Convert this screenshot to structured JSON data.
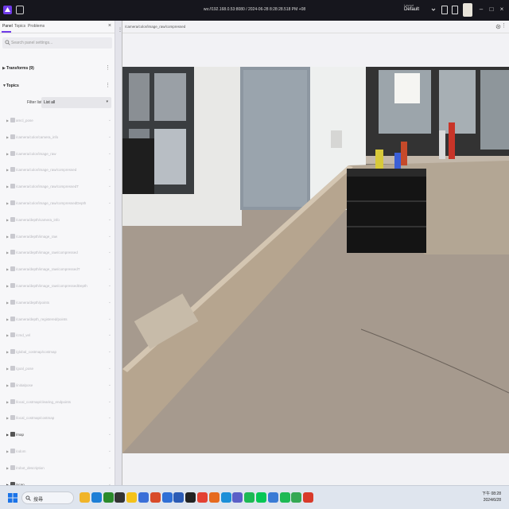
{
  "appbar": {
    "url": "ws://192.168.0.53:8080 / 2024-06-28 8:28:28.518 PM +08",
    "layout_label": "Layout",
    "layout_value": "Default"
  },
  "panel": {
    "tabs": [
      "Panel",
      "Topics",
      "Problems"
    ],
    "search_placeholder": "Search panel settings...",
    "transforms_label": "Transforms (9)",
    "topics_label": "Topics",
    "filter_label": "Filter list",
    "filter_value": "List all",
    "topics": [
      {
        "name": "amcl_pose",
        "strong": false
      },
      {
        "name": "/camera/color/camera_info",
        "strong": false
      },
      {
        "name": "/camera/color/image_raw",
        "strong": false
      },
      {
        "name": "/camera/color/image_raw/compressed",
        "strong": false
      },
      {
        "name": "/camera/color/image_raw/compressedT",
        "strong": false
      },
      {
        "name": "/camera/color/image_raw/compressedDepth",
        "strong": false
      },
      {
        "name": "/camera/depth/camera_info",
        "strong": false
      },
      {
        "name": "/camera/depth/image_raw",
        "strong": false
      },
      {
        "name": "/camera/depth/image_raw/compressed",
        "strong": false
      },
      {
        "name": "/camera/depth/image_raw/compressedT",
        "strong": false
      },
      {
        "name": "/camera/depth/image_raw/compressedDepth",
        "strong": false
      },
      {
        "name": "/camera/depth/points",
        "strong": false
      },
      {
        "name": "/camera/depth_registered/points",
        "strong": false
      },
      {
        "name": "/cmd_vel",
        "strong": false
      },
      {
        "name": "/global_costmap/costmap",
        "strong": false
      },
      {
        "name": "/goal_pose",
        "strong": false
      },
      {
        "name": "/initialpose",
        "strong": false
      },
      {
        "name": "/local_costmap/clearing_endpoints",
        "strong": false
      },
      {
        "name": "/local_costmap/costmap",
        "strong": false
      },
      {
        "name": "/map",
        "strong": true
      },
      {
        "name": "/odom",
        "strong": false
      },
      {
        "name": "/robot_description",
        "strong": false
      },
      {
        "name": "/scan",
        "strong": true
      }
    ]
  },
  "image_panel": {
    "topic": "/camera/color/image_raw/compressed"
  },
  "taskbar": {
    "search_placeholder": "搜尋",
    "time": "下午 08:28",
    "date": "2024/6/28",
    "apps": [
      {
        "name": "files-app",
        "color": "#f0b429"
      },
      {
        "name": "vscode-app",
        "color": "#1e7fd6"
      },
      {
        "name": "xbox-app",
        "color": "#2b8a2b"
      },
      {
        "name": "terminal-app",
        "color": "#333333"
      },
      {
        "name": "sticky-app",
        "color": "#f4c21a"
      },
      {
        "name": "photos-app",
        "color": "#3a6fd8"
      },
      {
        "name": "office-app",
        "color": "#d84b2a"
      },
      {
        "name": "calendar-app",
        "color": "#2f6fd6"
      },
      {
        "name": "word-app",
        "color": "#2b5bb5"
      },
      {
        "name": "terminal2-app",
        "color": "#222222"
      },
      {
        "name": "chrome-app",
        "color": "#e34133"
      },
      {
        "name": "firefox-app",
        "color": "#e66a1f"
      },
      {
        "name": "edge-app",
        "color": "#1c8fd8"
      },
      {
        "name": "teams-app",
        "color": "#5b5fc7"
      },
      {
        "name": "spotify-app",
        "color": "#1db954"
      },
      {
        "name": "line-app",
        "color": "#06c755"
      },
      {
        "name": "remote-app",
        "color": "#3a7bd5"
      },
      {
        "name": "spotify2-app",
        "color": "#1db954"
      },
      {
        "name": "maps-app",
        "color": "#34a853"
      },
      {
        "name": "brave-app",
        "color": "#d83a2a"
      }
    ]
  }
}
